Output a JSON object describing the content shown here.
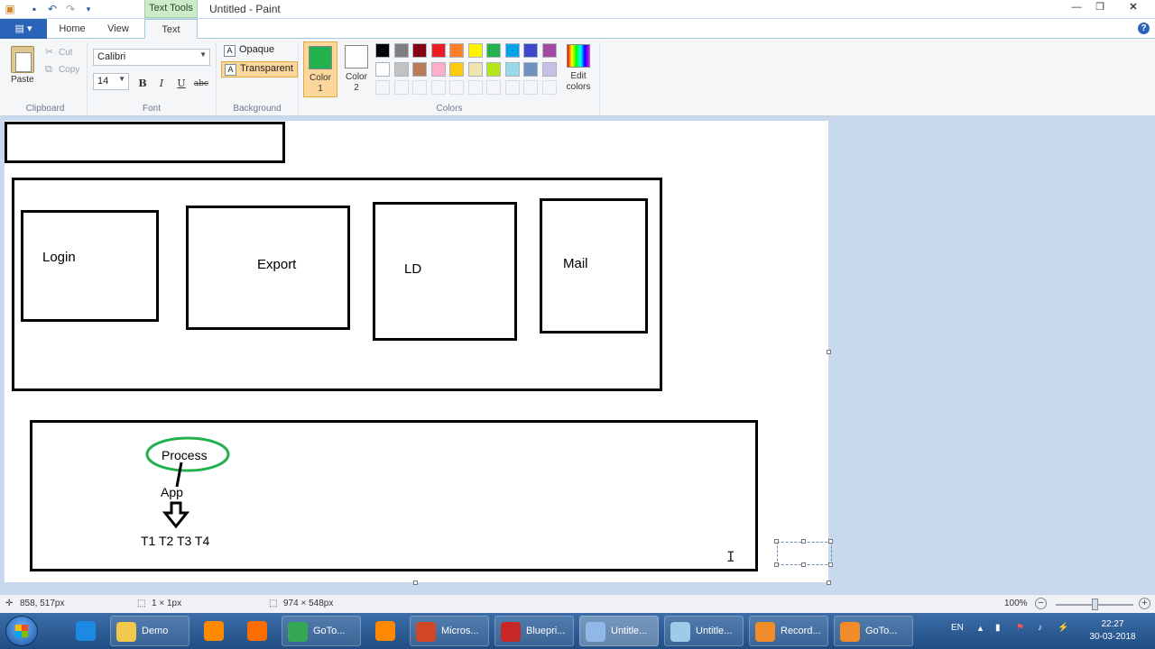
{
  "window": {
    "title": "Untitled - Paint",
    "contextual_tab": "Text Tools"
  },
  "tabs": {
    "home": "Home",
    "view": "View",
    "text": "Text"
  },
  "clipboard": {
    "paste": "Paste",
    "cut": "Cut",
    "copy": "Copy",
    "label": "Clipboard"
  },
  "font": {
    "family": "Calibri",
    "size": "14",
    "bold": "B",
    "italic": "I",
    "underline": "U",
    "strike": "abc",
    "label": "Font"
  },
  "background": {
    "opaque": "Opaque",
    "transparent": "Transparent",
    "label": "Background"
  },
  "colors": {
    "color1_label": "Color 1",
    "color2_label": "Color 2",
    "color1_value": "#22b14c",
    "color2_value": "#ffffff",
    "edit_colors": "Edit colors",
    "label": "Colors",
    "palette": [
      "#000000",
      "#7f7f7f",
      "#880015",
      "#ed1c24",
      "#ff7f27",
      "#fff200",
      "#22b14c",
      "#00a2e8",
      "#3f48cc",
      "#a349a4",
      "#ffffff",
      "#c3c3c3",
      "#b97a57",
      "#ffaec9",
      "#ffc90e",
      "#efe4b0",
      "#b5e61d",
      "#99d9ea",
      "#7092be",
      "#c8bfe7"
    ]
  },
  "canvas": {
    "labels": {
      "login": "Login",
      "export": "Export",
      "ld": "LD",
      "mail": "Mail",
      "process": "Process",
      "app": "App",
      "threads": "T1 T2 T3 T4"
    }
  },
  "status": {
    "cursor_pos": "858, 517px",
    "selection_size": "1 × 1px",
    "image_size": "974 × 548px",
    "zoom": "100%"
  },
  "taskbar": {
    "items": [
      {
        "label": "",
        "icon": "ie-icon"
      },
      {
        "label": "Demo",
        "icon": "folder-icon"
      },
      {
        "label": "",
        "icon": "media-player-icon"
      },
      {
        "label": "",
        "icon": "firefox-icon"
      },
      {
        "label": "GoTo...",
        "icon": "chrome-icon"
      },
      {
        "label": "",
        "icon": "vlc-icon"
      },
      {
        "label": "Micros...",
        "icon": "powerpoint-icon"
      },
      {
        "label": "Bluepri...",
        "icon": "pdf-icon"
      },
      {
        "label": "Untitle...",
        "icon": "paint-icon"
      },
      {
        "label": "Untitle...",
        "icon": "notepad-icon"
      },
      {
        "label": "Record...",
        "icon": "gotomeeting-icon"
      },
      {
        "label": "GoTo...",
        "icon": "gotomeeting-icon"
      }
    ],
    "lang": "EN",
    "time": "22:27",
    "date": "30-03-2018"
  }
}
